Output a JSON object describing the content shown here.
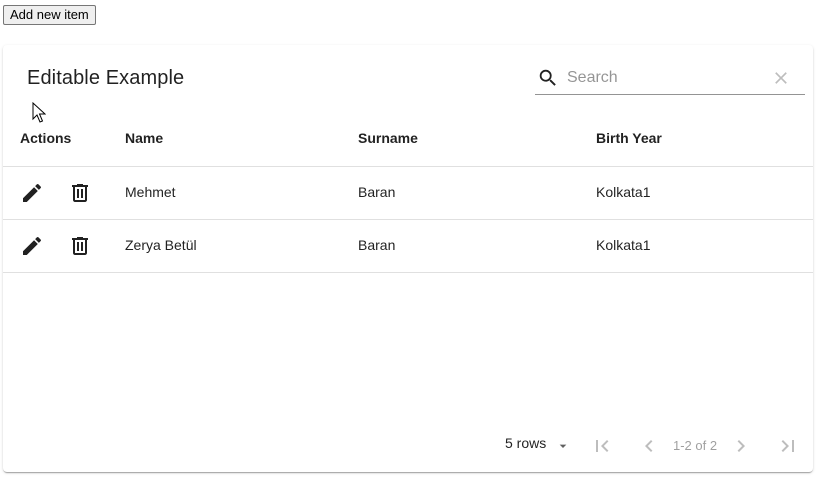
{
  "toolbar": {
    "add_label": "Add new item"
  },
  "table": {
    "title": "Editable Example",
    "search": {
      "placeholder": "Search",
      "value": ""
    },
    "columns": [
      "Actions",
      "Name",
      "Surname",
      "Birth Year"
    ],
    "rows": [
      {
        "name": "Mehmet",
        "surname": "Baran",
        "birth_year": "Kolkata1"
      },
      {
        "name": "Zerya Betül",
        "surname": "Baran",
        "birth_year": "Kolkata1"
      }
    ]
  },
  "pagination": {
    "rows_per_page": "5 rows",
    "range": "1-2 of 2"
  },
  "colors": {
    "icon": "#212121",
    "icon_disabled": "#bdbdbd",
    "divider": "#e0e0e0"
  },
  "icons": [
    "search-icon",
    "clear-icon",
    "edit-icon",
    "delete-icon",
    "first-page-icon",
    "prev-page-icon",
    "next-page-icon",
    "last-page-icon",
    "dropdown-arrow-icon"
  ]
}
